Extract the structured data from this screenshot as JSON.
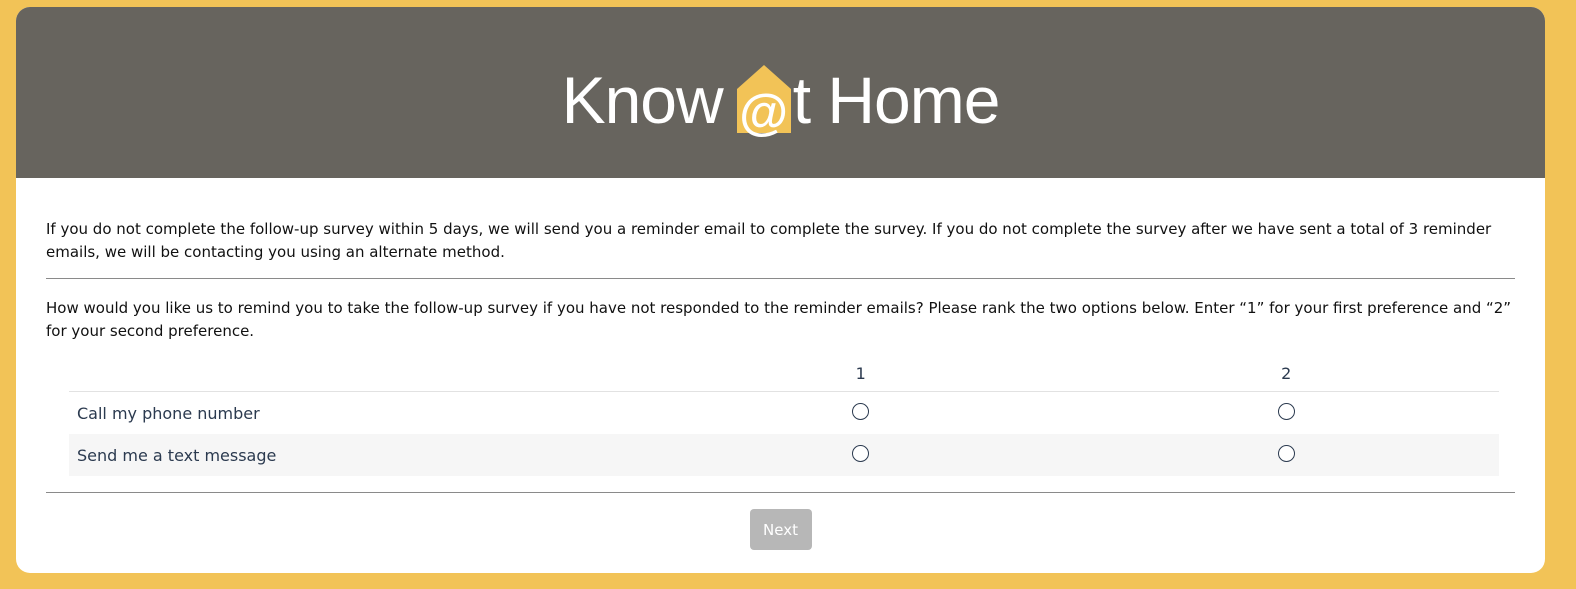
{
  "brand": {
    "logo_left": "Know",
    "logo_at": "@",
    "logo_right": "t Home",
    "header_color": "#67645e",
    "accent_color": "#f2c357"
  },
  "intro_text": "If you do not complete the follow-up survey within 5 days, we will send you a reminder email to complete the survey. If you do not complete the survey after we have sent a total of 3 reminder emails, we will be contacting you using an alternate method.",
  "question_text": "How would you like us to remind you to take the follow-up survey if you have not responded to the reminder emails? Please rank the two options below. Enter “1” for your first preference and “2” for your second preference.",
  "matrix": {
    "columns": [
      "1",
      "2"
    ],
    "rows": [
      {
        "label": "Call my phone number"
      },
      {
        "label": "Send me a text message"
      }
    ]
  },
  "next_button": "Next"
}
